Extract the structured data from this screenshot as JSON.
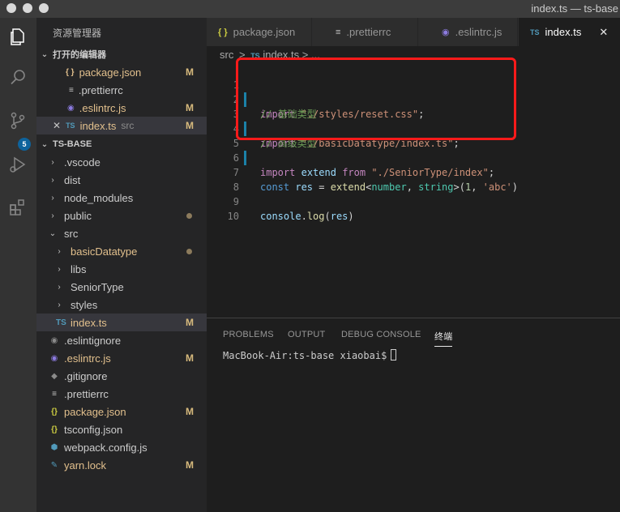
{
  "window": {
    "title": "index.ts — ts-base"
  },
  "activity_bar": {
    "icons": [
      "explorer-icon",
      "search-icon",
      "source-control-icon",
      "run-debug-icon",
      "extensions-icon"
    ],
    "scm_badge": "5"
  },
  "sidebar": {
    "title": "资源管理器",
    "open_editors_title": "打开的编辑器",
    "open_editors": [
      {
        "label": "package.json",
        "icon": "{ }",
        "status": "M"
      },
      {
        "label": ".prettierrc",
        "icon": "≡",
        "status": ""
      },
      {
        "label": ".eslintrc.js",
        "icon": "◉",
        "status": "M"
      },
      {
        "label": "index.ts",
        "icon": "TS",
        "path": "src",
        "status": "M"
      }
    ],
    "project_title": "TS-BASE",
    "tree": [
      {
        "label": ".vscode",
        "kind": "folder"
      },
      {
        "label": "dist",
        "kind": "folder"
      },
      {
        "label": "node_modules",
        "kind": "folder"
      },
      {
        "label": "public",
        "kind": "folder"
      },
      {
        "label": "src",
        "kind": "folder-open"
      },
      {
        "label": "basicDatatype",
        "kind": "folder"
      },
      {
        "label": "libs",
        "kind": "folder"
      },
      {
        "label": "SeniorType",
        "kind": "folder"
      },
      {
        "label": "styles",
        "kind": "folder"
      },
      {
        "label": "index.ts",
        "kind": "ts",
        "status": "M"
      },
      {
        "label": ".eslintignore",
        "kind": "file"
      },
      {
        "label": ".eslintrc.js",
        "kind": "file",
        "status": "M"
      },
      {
        "label": ".gitignore",
        "kind": "file"
      },
      {
        "label": ".prettierrc",
        "kind": "file"
      },
      {
        "label": "package.json",
        "kind": "json",
        "status": "M"
      },
      {
        "label": "tsconfig.json",
        "kind": "json"
      },
      {
        "label": "webpack.config.js",
        "kind": "file"
      },
      {
        "label": "yarn.lock",
        "kind": "file",
        "status": "M"
      }
    ]
  },
  "tabs": [
    {
      "label": "package.json",
      "icon": "{ }"
    },
    {
      "label": ".prettierrc",
      "icon": "≡"
    },
    {
      "label": ".eslintrc.js",
      "icon": "◉"
    },
    {
      "label": "index.ts",
      "icon": "TS",
      "close": "✕"
    }
  ],
  "breadcrumb": {
    "folder": "src",
    "sep": ">",
    "file_icon": "TS",
    "file": "index.ts",
    "more": "> ..."
  },
  "editor": {
    "line_numbers": [
      "1",
      "2",
      "3",
      "4",
      "5",
      "6",
      "7",
      "8",
      "9",
      "10"
    ],
    "line1": {
      "kw": "import",
      "str": "\"./styles/reset.css\"",
      "end": ";"
    },
    "line2": {
      "comment": "// 基础类型"
    },
    "line3": {
      "kw": "import",
      "str": "\"./basicDatatype/index.ts\"",
      "end": ";"
    },
    "line4": {
      "comment": "// 高级类型"
    },
    "line5": {
      "kw": "import",
      "name": "extend",
      "from": "from",
      "str": "\"./SeniorType/index\"",
      "end": ";"
    },
    "line7": {
      "decl": "const",
      "var": "res",
      "eq": " = ",
      "fn": "extend",
      "lt": "<",
      "t1": "number",
      "comma": ", ",
      "t2": "string",
      "gt": ">(",
      "n": "1",
      "c2": ", ",
      "s": "'abc'",
      "close": ")"
    },
    "line9": {
      "obj": "console",
      "dot": ".",
      "fn": "log",
      "open": "(",
      "arg": "res",
      "close": ")"
    }
  },
  "panel": {
    "tabs": [
      "PROBLEMS",
      "OUTPUT",
      "DEBUG CONSOLE",
      "终端"
    ],
    "prompt": "MacBook-Air:ts-base xiaobai$"
  },
  "colors": {
    "accent": "#0e639c",
    "highlight": "#ff1a1a",
    "modified": "#d7ba7d"
  }
}
